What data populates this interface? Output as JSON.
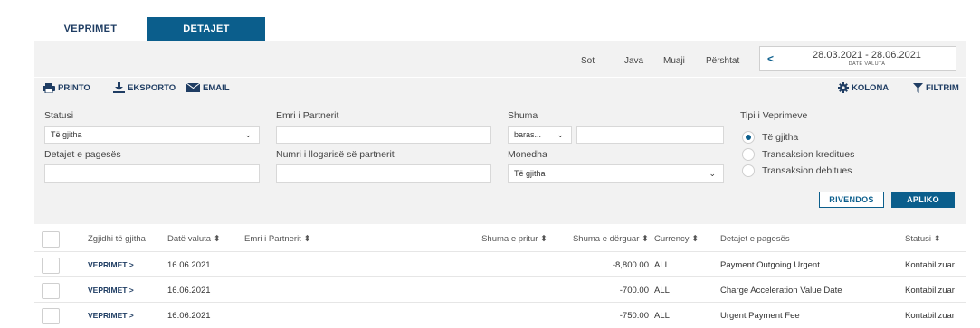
{
  "tabs": [
    {
      "label": "VEPRIMET",
      "active": true
    },
    {
      "label": "DETAJET",
      "active": false
    }
  ],
  "periods": [
    "Sot",
    "Java",
    "Muaji",
    "Përshtat"
  ],
  "date_range": {
    "value": "28.03.2021 - 28.06.2021",
    "caption": "DATË VALUTA"
  },
  "toolbar": {
    "print": "PRINTO",
    "export": "EKSPORTO",
    "email": "EMAIL",
    "columns": "KOLONA",
    "filter": "FILTRIM"
  },
  "filters": {
    "status_label": "Statusi",
    "status_value": "Të gjitha",
    "partner_label": "Emri i Partnerit",
    "partner_value": "",
    "amount_label": "Shuma",
    "amount_op": "baras...",
    "amount_value": "",
    "details_label": "Detajet e pagesës",
    "details_value": "",
    "account_label": "Numri i llogarisë së partnerit",
    "account_value": "",
    "currency_label": "Monedha",
    "currency_value": "Të gjitha",
    "type_label": "Tipi i Veprimeve",
    "type_options": [
      {
        "label": "Të gjitha",
        "selected": true
      },
      {
        "label": "Transaksion kreditues",
        "selected": false
      },
      {
        "label": "Transaksion debitues",
        "selected": false
      }
    ],
    "reset": "RIVENDOS",
    "apply": "APLIKO"
  },
  "table": {
    "headers": {
      "select_all": "Zgjidhi të gjitha",
      "value_date": "Datë valuta",
      "partner": "Emri i Partnerit",
      "received": "Shuma e pritur",
      "sent": "Shuma e dërguar",
      "currency": "Currency",
      "details": "Detajet e pagesës",
      "status": "Statusi"
    },
    "sort_icon": "⬍",
    "rows": [
      {
        "link": "VEPRIMET >",
        "date": "16.06.2021",
        "partner": "",
        "received": "",
        "sent": "-8,800.00",
        "currency": "ALL",
        "details": "Payment Outgoing Urgent",
        "status": "Kontabilizuar"
      },
      {
        "link": "VEPRIMET >",
        "date": "16.06.2021",
        "partner": "",
        "received": "",
        "sent": "-700.00",
        "currency": "ALL",
        "details": "Charge Acceleration Value Date",
        "status": "Kontabilizuar"
      },
      {
        "link": "VEPRIMET >",
        "date": "16.06.2021",
        "partner": "",
        "received": "",
        "sent": "-750.00",
        "currency": "ALL",
        "details": "Urgent Payment Fee",
        "status": "Kontabilizuar"
      }
    ]
  }
}
